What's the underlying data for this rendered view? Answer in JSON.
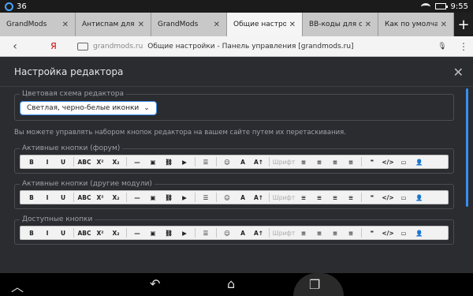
{
  "statusbar": {
    "battery": "36",
    "time": "9:55"
  },
  "tabs": [
    {
      "label": "GrandMods",
      "active": false
    },
    {
      "label": "Антиспам для к",
      "active": false
    },
    {
      "label": "GrandMods",
      "active": false
    },
    {
      "label": "Общие настрой",
      "active": true
    },
    {
      "label": "BB-коды для ст",
      "active": false
    },
    {
      "label": "Как по умолчан",
      "active": false
    }
  ],
  "url": {
    "brand": "Я",
    "domain": "grandmods.ru",
    "title": "Общие настройки - Панель управления [grandmods.ru]"
  },
  "modal": {
    "title": "Настройка редактора",
    "scheme_legend": "Цветовая схема редактора",
    "scheme_value": "Светлая, черно-белые иконки",
    "hint": "Вы можете управлять набором кнопок редактора на вашем сайте путем их перетаскивания.",
    "groups": [
      {
        "legend": "Активные кнопки (форум)"
      },
      {
        "legend": "Активные кнопки (другие модули)"
      },
      {
        "legend": "Доступные кнопки"
      }
    ],
    "font_label": "Шрифт"
  },
  "toolbar_icons": [
    "B",
    "I",
    "U",
    "ABC",
    "X²",
    "X₂",
    "—",
    "▣",
    "⛓",
    "▶",
    "☰",
    "☺",
    "A",
    "A↑",
    "Шрифт",
    "≡",
    "≡",
    "≡",
    "≡",
    "❞",
    "</>",
    "▭",
    "👤"
  ]
}
